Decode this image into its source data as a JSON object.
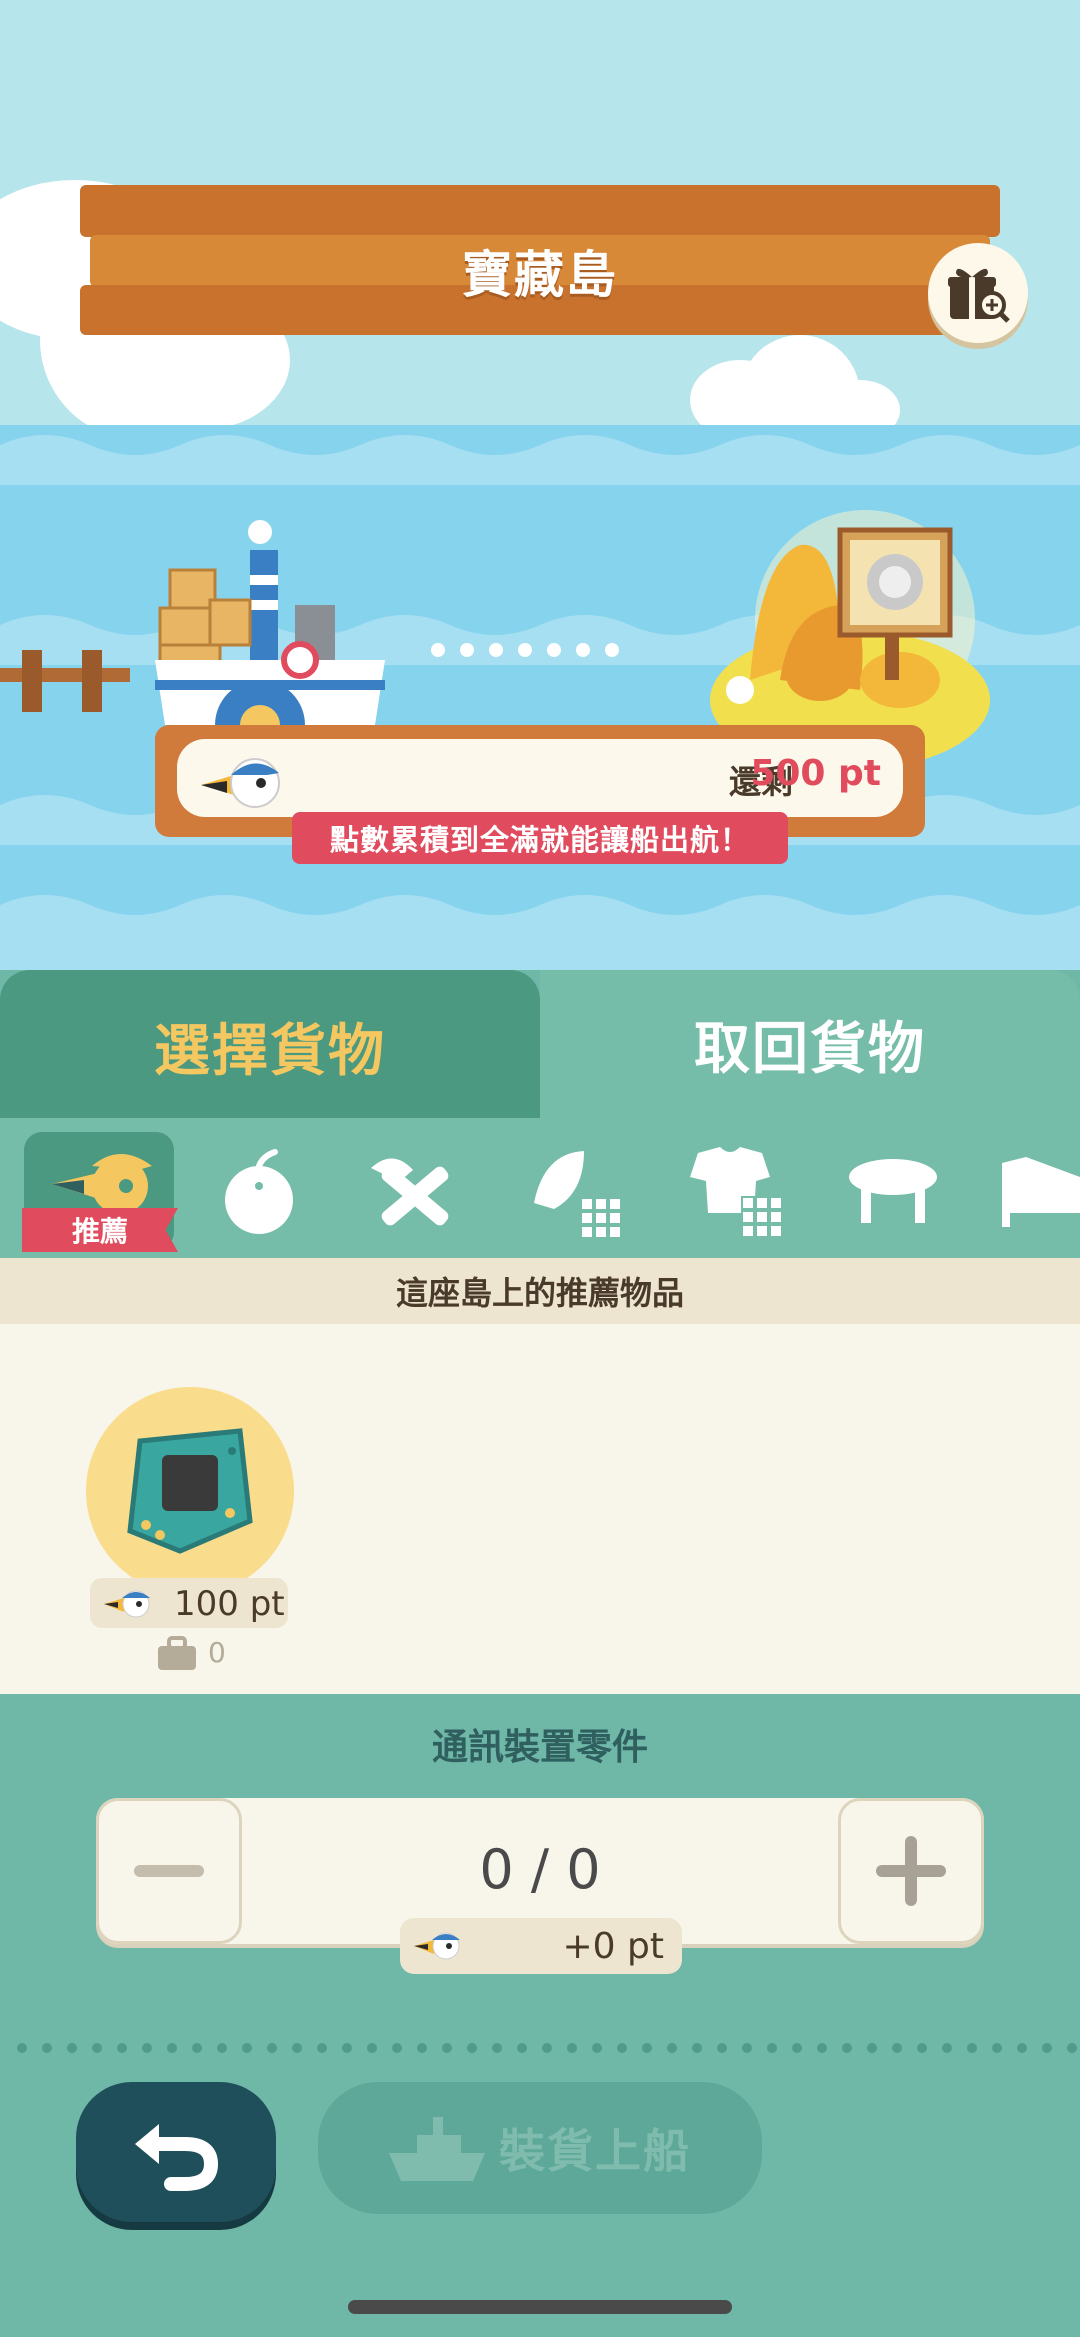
{
  "header": {
    "title": "寶藏島",
    "gift_icon": "gift-magnify-icon"
  },
  "voyage": {
    "points_label": "還剩",
    "points_value": "500 pt",
    "hint": "點數累積到全滿就能讓船出航！",
    "progress_dots": 7
  },
  "tabs": [
    {
      "label": "選擇貨物",
      "active": true
    },
    {
      "label": "取回貨物",
      "active": false
    }
  ],
  "categories": [
    {
      "name": "recommended",
      "label": "推薦",
      "icon": "pelican-icon",
      "active": true
    },
    {
      "name": "fruit",
      "icon": "apple-icon"
    },
    {
      "name": "tools",
      "icon": "tools-icon"
    },
    {
      "name": "leaf",
      "icon": "leaf-grid-icon"
    },
    {
      "name": "clothing",
      "icon": "shirt-grid-icon"
    },
    {
      "name": "table",
      "icon": "table-icon"
    },
    {
      "name": "bed",
      "icon": "bed-icon"
    }
  ],
  "section_header": "這座島上的推薦物品",
  "items": [
    {
      "price": "100 pt",
      "owned": "0",
      "icon": "circuit-board-icon"
    }
  ],
  "selected_item": {
    "name": "通訊裝置零件",
    "quantity": "0 / 0",
    "points_added": "+0 pt"
  },
  "actions": {
    "load_label": "裝貨上船"
  },
  "colors": {
    "accent_red": "#e04b5e",
    "tab_active": "#4a9980",
    "tab_inactive": "#76bda9",
    "active_tab_text": "#f4c760"
  }
}
